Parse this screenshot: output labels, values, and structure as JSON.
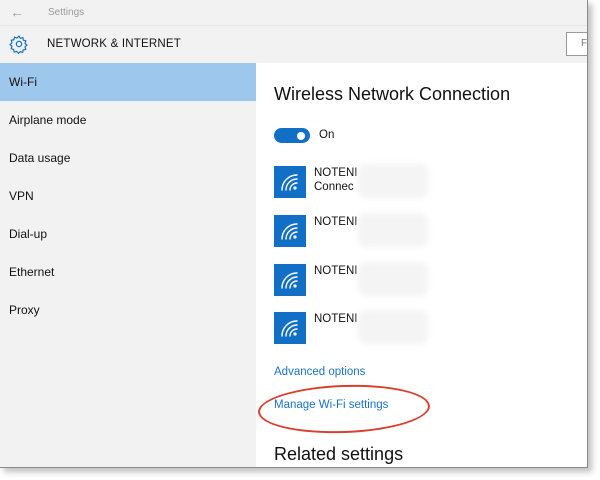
{
  "titlebar": {
    "back_glyph": "←",
    "app_title": "Settings"
  },
  "header": {
    "section_title": "NETWORK & INTERNET",
    "search_text": "F"
  },
  "sidebar": {
    "items": [
      {
        "label": "Wi-Fi",
        "selected": true
      },
      {
        "label": "Airplane mode"
      },
      {
        "label": "Data usage"
      },
      {
        "label": "VPN"
      },
      {
        "label": "Dial-up"
      },
      {
        "label": "Ethernet"
      },
      {
        "label": "Proxy"
      }
    ]
  },
  "content": {
    "title": "Wireless Network Connection",
    "toggle": {
      "state": "On"
    },
    "networks": [
      {
        "name": "NOTENI",
        "status": "Connec"
      },
      {
        "name": "NOTENI"
      },
      {
        "name": "NOTENI"
      },
      {
        "name": "NOTENI"
      }
    ],
    "advanced_options": "Advanced options",
    "manage_wifi": "Manage Wi-Fi settings",
    "related_title": "Related settings"
  },
  "colors": {
    "accent": "#1170c5",
    "selected_bg": "#9ec7ee",
    "link": "#1a73c8",
    "annotation": "#d8412f"
  },
  "icons": {
    "back": "back-arrow-icon",
    "settings": "gear-icon",
    "network": "wifi-icon"
  }
}
